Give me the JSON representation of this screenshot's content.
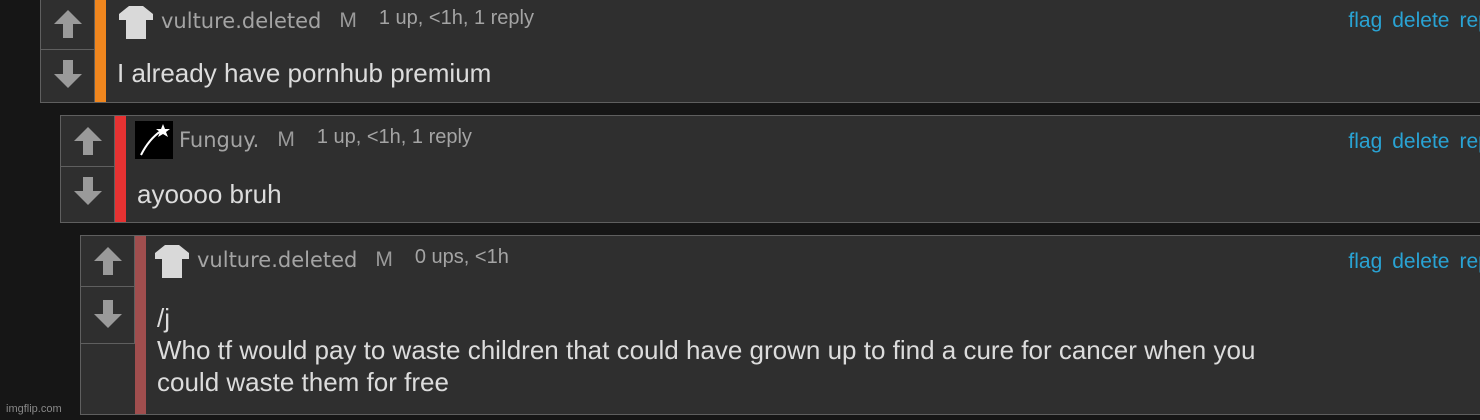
{
  "comments": [
    {
      "username": "vulture.deleted",
      "gender": "M",
      "meta": "1 up, <1h, 1 reply",
      "actions": [
        "flag",
        "delete",
        "reply"
      ],
      "body": "I already have pornhub premium",
      "stripe_color": "#f0861e",
      "avatar_icon": "blank-tshirt-icon"
    },
    {
      "username": "Funguy.",
      "gender": "M",
      "meta": "1 up, <1h, 1 reply",
      "actions": [
        "flag",
        "delete",
        "reply"
      ],
      "body": "ayoooo bruh",
      "stripe_color": "#e63232",
      "avatar_icon": "shooting-star-icon"
    },
    {
      "username": "vulture.deleted",
      "gender": "M",
      "meta": "0 ups, <1h",
      "actions": [
        "flag",
        "delete",
        "reply"
      ],
      "body": "/j\nWho tf would pay to waste children that could have grown up to find a cure for cancer when you\ncould waste them for free",
      "stripe_color": "#a04e4e",
      "avatar_icon": "blank-tshirt-icon"
    }
  ],
  "watermark": "imgflip.com",
  "colors": {
    "link": "#29a3d4",
    "panel": "#2f2f2f",
    "background": "#161616"
  }
}
